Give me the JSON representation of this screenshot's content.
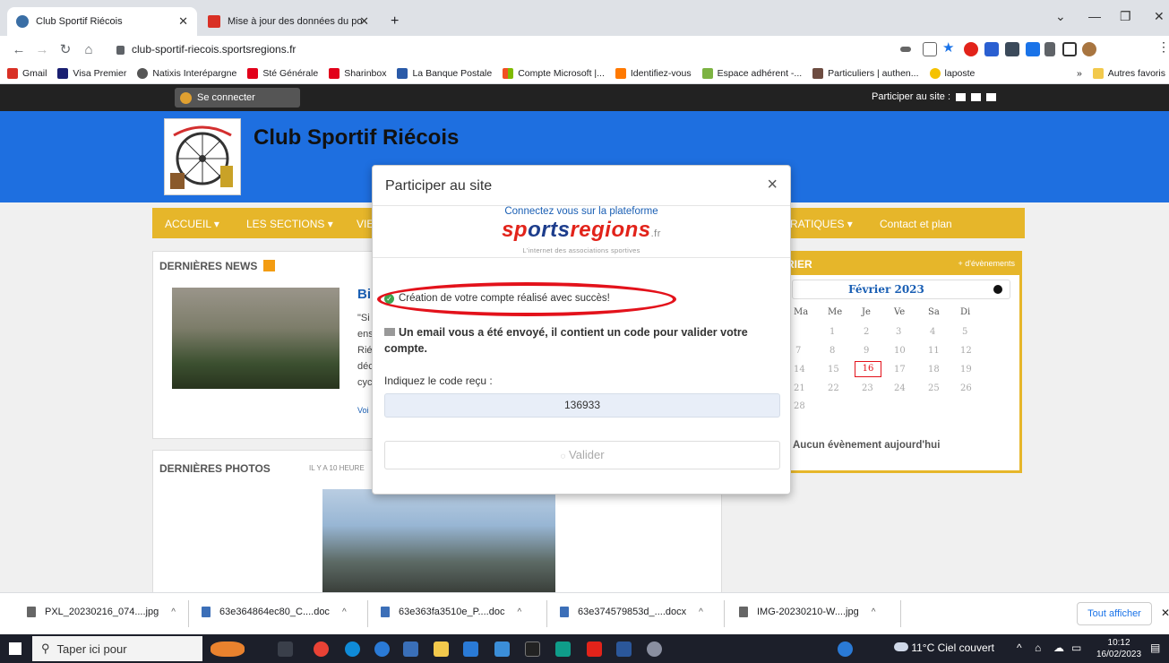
{
  "browser": {
    "tabs": [
      {
        "title": "Club Sportif Riécois"
      },
      {
        "title": "Mise à jour des données du port"
      }
    ],
    "url": "club-sportif-riecois.sportsregions.fr",
    "bookmarks": [
      "Gmail",
      "Visa Premier",
      "Natixis Interépargne",
      "Sté Générale",
      "Sharinbox",
      "La Banque Postale",
      "Compte Microsoft |...",
      "Identifiez-vous",
      "Espace adhérent -...",
      "Particuliers | authen...",
      "laposte"
    ],
    "other_bookmarks": "Autres favoris",
    "more": "»"
  },
  "site": {
    "login_label": "Se connecter",
    "participer_label": "Participer au site :",
    "title": "Club Sportif Riécois",
    "menu": [
      "ACCUEIL ▾",
      "LES SECTIONS ▾",
      "VIE",
      "RATIQUES ▾",
      "Contact et plan"
    ],
    "news_title": "DERNIÈRES NEWS",
    "news_snippet_title": "Bi",
    "news_snippet_lines": [
      "\"Si",
      "ens",
      "Rié",
      "déc",
      "cyc"
    ],
    "news_more": "Voi",
    "photos_title": "DERNIÈRES PHOTOS",
    "photos_time": "IL Y A 10 HEURE",
    "calendar": {
      "title": "RIER",
      "more_events": "+ d'évènements",
      "month": "Février 2023",
      "days": [
        "Ma",
        "Me",
        "Je",
        "Ve",
        "Sa",
        "Di"
      ],
      "rows": [
        [
          "",
          "1",
          "2",
          "3",
          "4",
          "5"
        ],
        [
          "7",
          "8",
          "9",
          "10",
          "11",
          "12"
        ],
        [
          "14",
          "15",
          "16",
          "17",
          "18",
          "19"
        ],
        [
          "21",
          "22",
          "23",
          "24",
          "25",
          "26"
        ],
        [
          "28",
          "",
          "",
          "",
          "",
          ""
        ]
      ],
      "today": "16",
      "no_event": "Aucun évènement aujourd'hui"
    }
  },
  "modal": {
    "title": "Participer au site",
    "close": "×",
    "connect_text": "Connectez vous sur la plateforme",
    "brand_a": "sp",
    "brand_b": "orts",
    "brand_c": "regions",
    "brand_tld": ".fr",
    "tagline": "L'internet des associations sportives",
    "success": "Création de votre compte réalisé avec succès!",
    "email_msg": "Un email vous a été envoyé, il contient un code pour valider votre compte.",
    "code_label": "Indiquez le code reçu :",
    "code_value": "136933",
    "validate": "Valider"
  },
  "downloads": {
    "items": [
      "PXL_20230216_074....jpg",
      "63e364864ec80_C....doc",
      "63e363fa3510e_P....doc",
      "63e374579853d_....docx",
      "IMG-20230210-W....jpg"
    ],
    "show_all": "Tout afficher"
  },
  "taskbar": {
    "search_placeholder": "Taper ici pour",
    "weather": "11°C Ciel couvert",
    "time": "10:12",
    "date": "16/02/2023"
  }
}
